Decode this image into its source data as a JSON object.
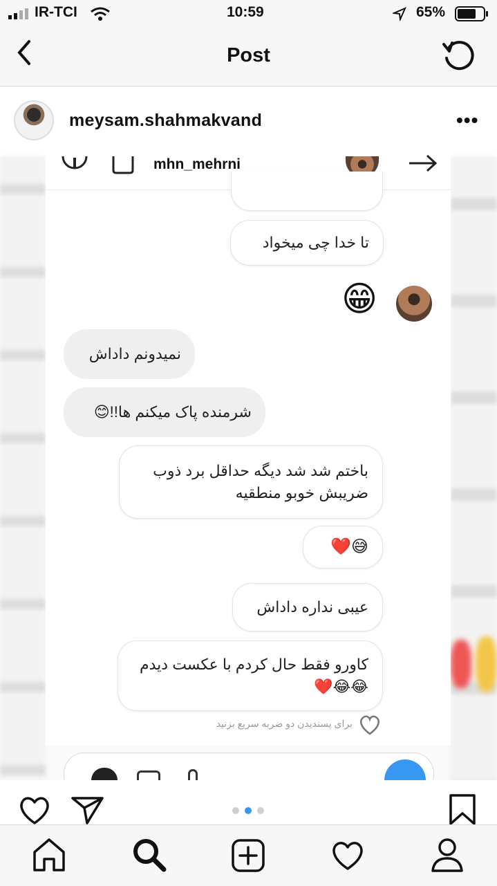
{
  "status_bar": {
    "carrier": "IR-TCI",
    "time": "10:59",
    "battery": "65%"
  },
  "nav": {
    "title": "Post",
    "back_icon": "chevron-left-icon",
    "refresh_icon": "refresh-icon"
  },
  "post": {
    "username": "meysam.shahmakvand",
    "more": "•••"
  },
  "dm": {
    "username": "mhn_mehrni",
    "messages": [
      {
        "text": "تا خدا چی میخواد",
        "side": "out"
      },
      {
        "text": "😁",
        "side": "in-emoji"
      },
      {
        "text": "نمیدونم داداش",
        "side": "in"
      },
      {
        "text": "شرمنده پاک میکنم ها!!😊",
        "side": "in"
      },
      {
        "text": "باختم شد شد دیگه حداقل برد ذوب ضریبش خوبو منطقیه",
        "side": "out"
      },
      {
        "text": "😅❤️",
        "side": "out"
      },
      {
        "text": "عیبی نداره داداش",
        "side": "out"
      },
      {
        "text": "کاورو فقط حال کردم با عکست دیدم😂😂❤️",
        "side": "out"
      }
    ],
    "hint": "برای پسندیدن دو ضربه سریع بزنید"
  },
  "carousel": {
    "count": 3,
    "active": 2
  },
  "tabs": [
    "home-icon",
    "search-icon",
    "new-post-icon",
    "activity-icon",
    "profile-icon"
  ],
  "colors": {
    "accent": "#3897f0",
    "heart_red": "#e0263a"
  }
}
